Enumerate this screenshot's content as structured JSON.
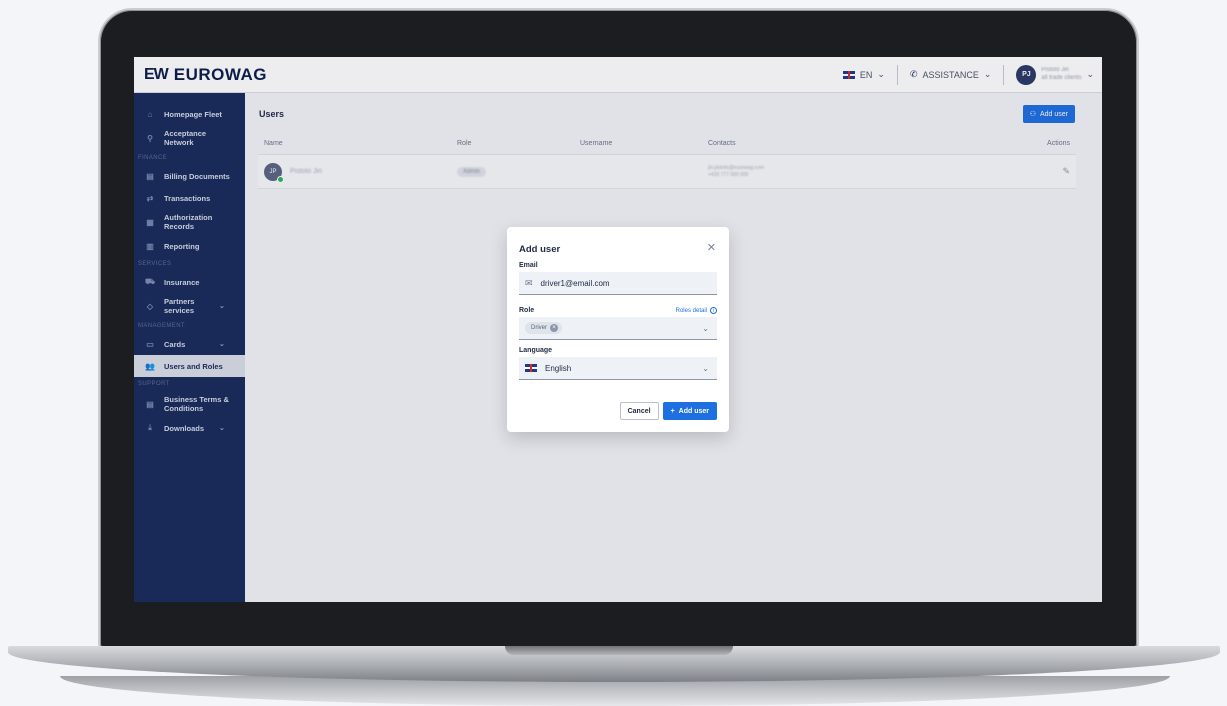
{
  "brand": {
    "mark": "EW",
    "name": "EUROWAG"
  },
  "topbar": {
    "language": "EN",
    "assistance": "ASSISTANCE",
    "user_initials": "PJ",
    "user_name": "Pistolo Jiri",
    "user_company": "all trade clients"
  },
  "sidebar": {
    "items": [
      {
        "label": "Homepage Fleet",
        "icon": "home-icon"
      },
      {
        "label": "Acceptance Network",
        "icon": "location-pin-icon"
      }
    ],
    "finance_label": "FINANCE",
    "finance_items": [
      {
        "label": "Billing Documents",
        "icon": "document-icon"
      },
      {
        "label": "Transactions",
        "icon": "transfer-icon"
      },
      {
        "label": "Authorization Records",
        "icon": "records-icon"
      },
      {
        "label": "Reporting",
        "icon": "report-icon"
      }
    ],
    "services_label": "SERVICES",
    "services_items": [
      {
        "label": "Insurance",
        "icon": "insurance-icon"
      },
      {
        "label": "Partners services",
        "icon": "handshake-icon"
      }
    ],
    "management_label": "MANAGEMENT",
    "management_items": [
      {
        "label": "Cards",
        "icon": "card-icon"
      },
      {
        "label": "Users and Roles",
        "icon": "users-icon"
      }
    ],
    "support_label": "SUPPORT",
    "support_items": [
      {
        "label": "Business Terms & Conditions",
        "icon": "terms-icon"
      },
      {
        "label": "Downloads",
        "icon": "download-icon"
      }
    ]
  },
  "main": {
    "title": "Users",
    "add_user_label": "Add user",
    "columns": [
      "Name",
      "Role",
      "Username",
      "Contacts",
      "Actions"
    ],
    "row": {
      "initials": "JP",
      "name": "Pistolo Jiri",
      "role": "Admin",
      "username": "",
      "email": "jiri.pistolo@eurowag.com",
      "phone": "+420 777 000 000"
    }
  },
  "modal": {
    "title": "Add user",
    "email_label": "Email",
    "email_value": "driver1@email.com",
    "role_label": "Role",
    "roles_detail": "Roles detail",
    "role_chip": "Driver",
    "language_label": "Language",
    "language_value": "English",
    "cancel_label": "Cancel",
    "add_label": "Add user"
  }
}
